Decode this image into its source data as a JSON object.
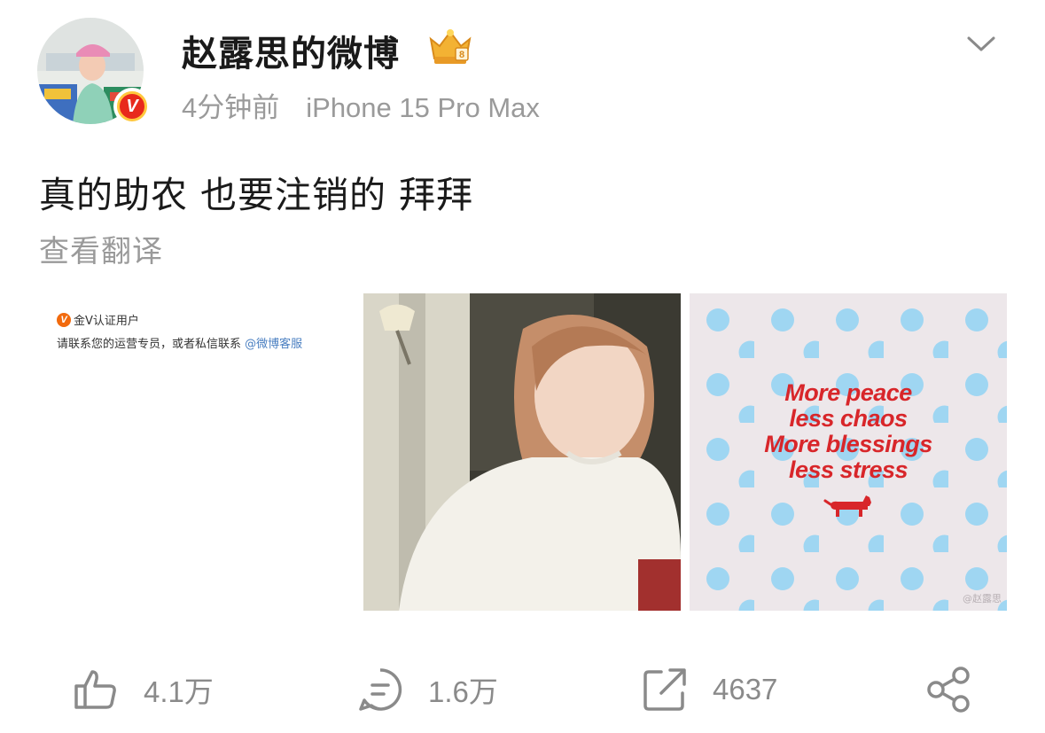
{
  "header": {
    "username": "赵露思的微博",
    "time": "4分钟前",
    "device": "iPhone 15 Pro Max",
    "verified_badge_letter": "V",
    "crown_badge_text": "8"
  },
  "post": {
    "text": "真的助农 也要注销的 拜拜",
    "translate_label": "查看翻译"
  },
  "images": {
    "cert_badge_letter": "V",
    "cert_title": "金V认证用户",
    "cert_message": "请联系您的运营专员，或者私信联系",
    "cert_link": "@微博客服",
    "poster_lines": [
      "More peace",
      "less chaos",
      "More blessings",
      "less stress"
    ],
    "watermark": "@赵露思"
  },
  "actions": {
    "like_count": "4.1万",
    "comment_count": "1.6万",
    "repost_count": "4637"
  },
  "colors": {
    "background": "#ffffff",
    "text_primary": "#1a1a1a",
    "text_secondary": "#9a9a9a",
    "verified_red": "#e8291c",
    "crown_gold": "#f3b233",
    "poster_red": "#d8262a",
    "poster_dots": "#9fd6f2",
    "link_blue": "#4a7fc1"
  },
  "icons": {
    "more": "chevron-down-icon",
    "like": "thumbs-up-icon",
    "comment": "comment-icon",
    "repost": "repost-icon",
    "share": "share-icon"
  }
}
